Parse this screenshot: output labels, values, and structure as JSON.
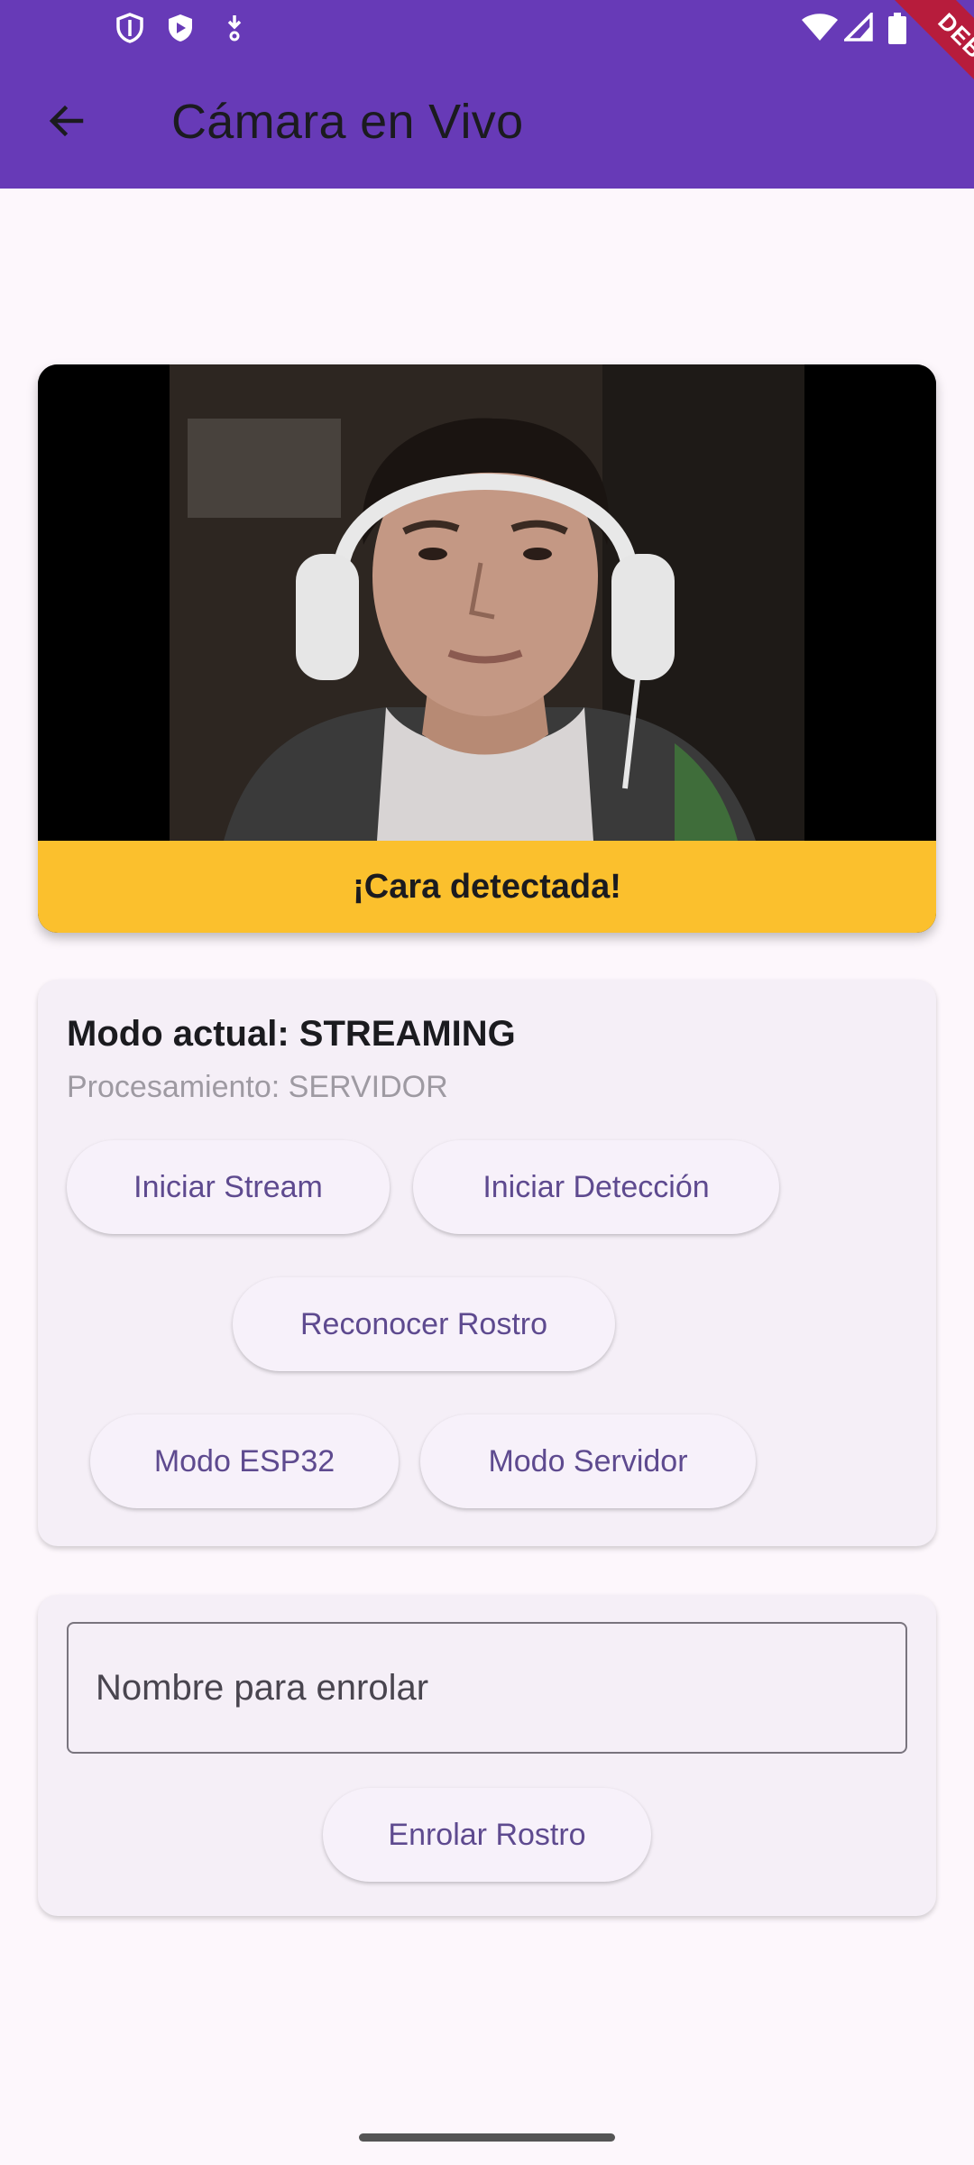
{
  "app_bar": {
    "title": "Cámara en Vivo",
    "debug_banner": "DEBUG",
    "background": "#673ab7"
  },
  "status_bar": {
    "left_icons": [
      "shield-icon",
      "play-store-icon",
      "download-icon"
    ],
    "right_icons": [
      "wifi-icon",
      "signal-icon",
      "battery-icon"
    ]
  },
  "video": {
    "status_text": "¡Cara detectada!",
    "status_color": "#fbc02d"
  },
  "mode_card": {
    "title": "Modo actual: STREAMING",
    "subtitle": "Procesamiento: SERVIDOR",
    "buttons": {
      "start_stream": "Iniciar Stream",
      "start_detection": "Iniciar Detección",
      "recognize_face": "Reconocer Rostro",
      "mode_esp32": "Modo ESP32",
      "mode_server": "Modo Servidor"
    }
  },
  "enroll_card": {
    "name_label": "Nombre para enrolar",
    "enroll_button": "Enrolar Rostro"
  }
}
